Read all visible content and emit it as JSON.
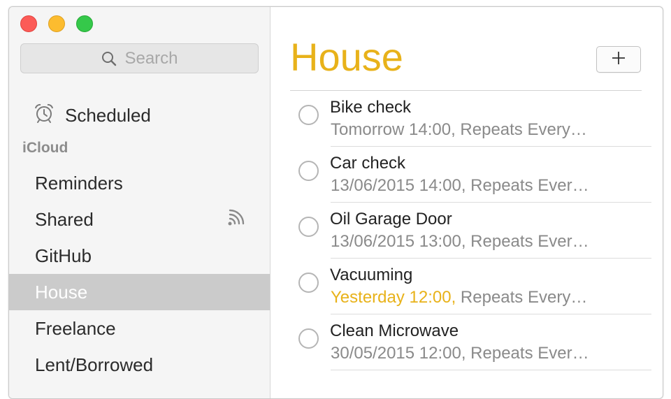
{
  "sidebar": {
    "search": {
      "placeholder": "Search"
    },
    "scheduled_label": "Scheduled",
    "section_header": "iCloud",
    "lists": [
      {
        "label": "Reminders",
        "shared": false,
        "selected": false
      },
      {
        "label": "Shared",
        "shared": true,
        "selected": false
      },
      {
        "label": "GitHub",
        "shared": false,
        "selected": false
      },
      {
        "label": "House",
        "shared": false,
        "selected": true
      },
      {
        "label": "Freelance",
        "shared": false,
        "selected": false
      },
      {
        "label": "Lent/Borrowed",
        "shared": false,
        "selected": false
      }
    ]
  },
  "main": {
    "title": "House",
    "add_button_icon": "plus-icon",
    "reminders": [
      {
        "title": "Bike check",
        "date": "Tomorrow 14:00,",
        "repeat": " Repeats Every…",
        "overdue": false
      },
      {
        "title": "Car check",
        "date": "13/06/2015 14:00,",
        "repeat": " Repeats Ever…",
        "overdue": false
      },
      {
        "title": "Oil Garage Door",
        "date": "13/06/2015 13:00,",
        "repeat": " Repeats Ever…",
        "overdue": false
      },
      {
        "title": "Vacuuming",
        "date": "Yesterday 12:00,",
        "repeat": " Repeats Every…",
        "overdue": true
      },
      {
        "title": "Clean Microwave",
        "date": "30/05/2015 12:00,",
        "repeat": " Repeats Ever…",
        "overdue": false
      }
    ]
  },
  "colors": {
    "accent": "#e8b21a",
    "selection": "#cbcbcb",
    "close": "#fc5b57",
    "minimize": "#fcbc2f",
    "zoom": "#35c84a"
  }
}
